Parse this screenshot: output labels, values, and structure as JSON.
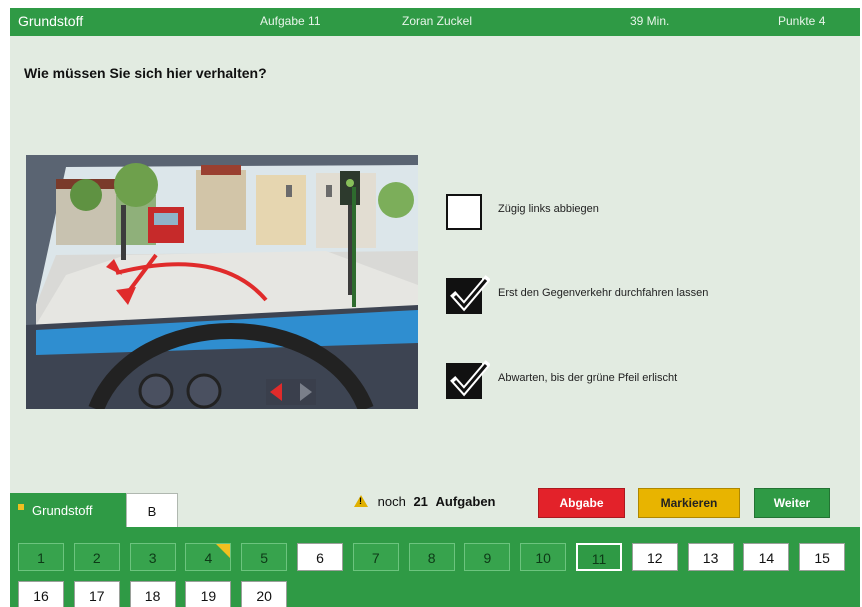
{
  "header": {
    "title": "Grundstoff",
    "task": "Aufgabe  11",
    "user": "Zoran  Zuckel",
    "time": "39 Min.",
    "points": "Punkte  4"
  },
  "question": "Wie müssen Sie sich hier verhalten?",
  "answers": [
    {
      "label": "Zügig links abbiegen",
      "checked": false
    },
    {
      "label": "Erst den Gegenverkehr durchfahren lassen",
      "checked": true
    },
    {
      "label": "Abwarten, bis der grüne Pfeil erlischt",
      "checked": true
    }
  ],
  "tabs": {
    "grundstoff": "Grundstoff",
    "b": "B"
  },
  "remaining": {
    "prefix": "noch",
    "count": "21",
    "suffix": "Aufgaben"
  },
  "buttons": {
    "abgabe": "Abgabe",
    "markieren": "Markieren",
    "weiter": "Weiter"
  },
  "task_numbers": [
    "1",
    "2",
    "3",
    "4",
    "5",
    "6",
    "7",
    "8",
    "9",
    "10",
    "11",
    "12",
    "13",
    "14",
    "15",
    "16",
    "17",
    "18",
    "19",
    "20"
  ],
  "task_states": {
    "done": [
      "1",
      "2",
      "3",
      "4",
      "5",
      "7",
      "8",
      "9",
      "10"
    ],
    "current": "11",
    "marked": [
      "4"
    ]
  },
  "colors": {
    "header_green": "#2f9a45",
    "background": "#e2ebe1",
    "abgabe_red": "#e3222a",
    "markieren_yellow": "#e8b400",
    "weiter_green": "#2f9a45"
  }
}
